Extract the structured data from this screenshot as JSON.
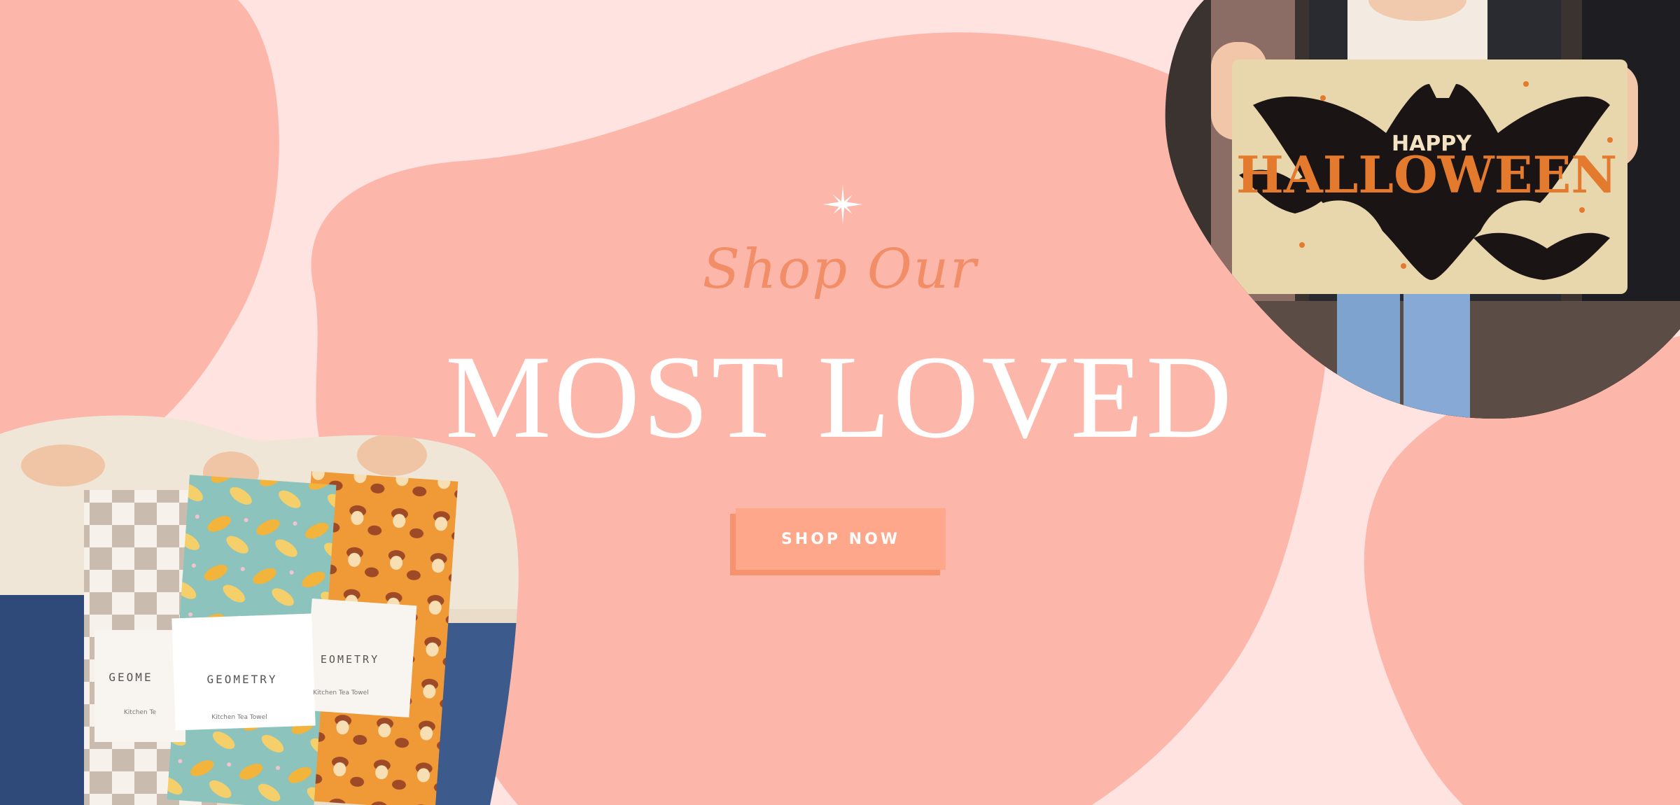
{
  "hero": {
    "script_heading": "Shop Our",
    "main_heading": "MOST LOVED",
    "cta_label": "SHOP NOW"
  },
  "towels": {
    "brand": "GEOMETRY",
    "product": "Kitchen Tea Towel",
    "brand_partial": "GEOME",
    "brand_partial_right": "EOMETRY",
    "product_partial": "Kitchen Te"
  },
  "doormat": {
    "text_small": "HAPPY",
    "text_large": "HALLOWEEN"
  },
  "colors": {
    "background": "#ffe3e1",
    "blob": "#fdb6aa",
    "script_accent": "#f28e67",
    "button": "#ffa78a",
    "button_shadow": "#f6926d",
    "heading": "#ffffff"
  },
  "icons": {
    "sparkle": "sparkle-icon"
  }
}
